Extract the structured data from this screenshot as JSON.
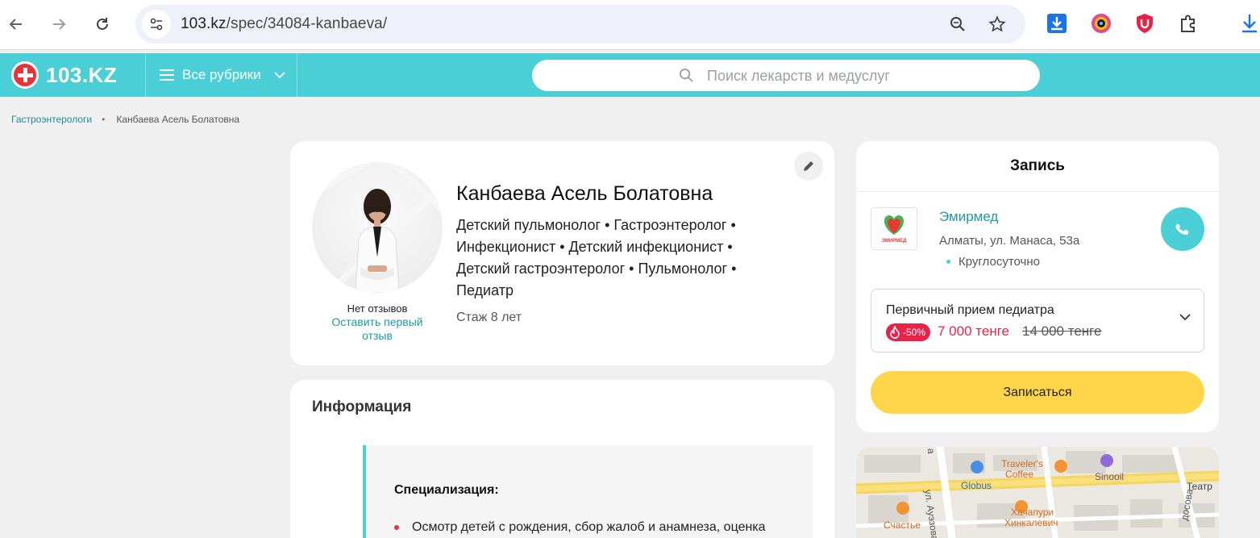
{
  "browser": {
    "url_host": "103.kz",
    "url_path": "/spec/34084-kanbaeva/"
  },
  "header": {
    "logo_text": "103.KZ",
    "rubrics_label": "Все рубрики",
    "search_placeholder": "Поиск лекарств и медуслуг"
  },
  "breadcrumb": {
    "parent": "Гастроэнтерологи",
    "separator": "•",
    "current": "Канбаева Асель Болатовна"
  },
  "profile": {
    "name": "Канбаева Асель Болатовна",
    "spec_lines": [
      "Детский пульмонолог • Гастроэнтеролог •",
      "Инфекционист • Детский инфекционист •",
      "Детский гастроэнтеролог • Пульмонолог •",
      "Педиатр"
    ],
    "experience": "Стаж 8 лет",
    "no_reviews": "Нет отзывов",
    "first_review_line1": "Оставить первый",
    "first_review_line2": "отзыв"
  },
  "info": {
    "title": "Информация",
    "spec_heading": "Специализация:",
    "first_item": "Осмотр детей с рождения, сбор жалоб и анамнеза, оценка"
  },
  "booking": {
    "title": "Запись",
    "clinic_name": "Эмирмед",
    "clinic_logo_text": "ЭМИРМЕД",
    "clinic_address": "Алматы, ул. Манаса, 53а",
    "clinic_hours": "Круглосуточно",
    "service_name": "Первичный прием педиатра",
    "discount": "-50%",
    "price_new": "7 000 тенге",
    "price_old": "14 000 тенге",
    "book_button": "Записаться"
  },
  "map": {
    "labels": {
      "travelers": "Traveler's",
      "coffee": "Coffee",
      "globus": "Globus",
      "sinooil": "Sinooil",
      "teatr": "Театр",
      "auezova": "ул. Ауэзова",
      "khachapuri": "Хачапури",
      "khinkalevich": "Хинкалевич",
      "schastye": "Счастье",
      "dosova": "досова",
      "a_fragment": "а"
    }
  },
  "colors": {
    "brand_teal": "#4acfd6",
    "accent_red": "#e8234a",
    "book_yellow": "#ffd54a",
    "link_teal": "#1f9aa2"
  }
}
